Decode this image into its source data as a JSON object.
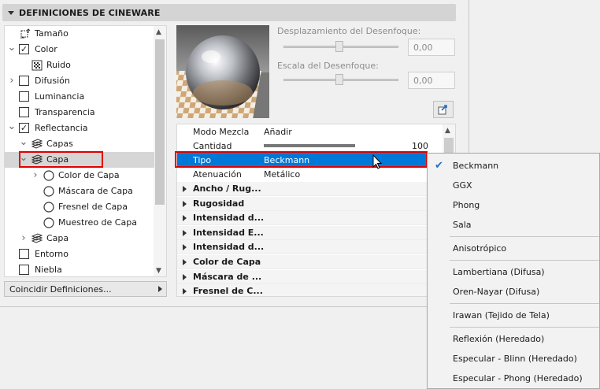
{
  "panel": {
    "title": "DEFINICIONES DE CINEWARE",
    "match_button_label": "Coincidir Definiciones..."
  },
  "tree": {
    "items": [
      {
        "label": "Tamaño",
        "icon": "resize-icon",
        "checkbox": null,
        "expander": null
      },
      {
        "label": "Color",
        "icon": null,
        "checkbox": true,
        "expander": "expanded"
      },
      {
        "label": "Ruido",
        "icon": "noise-icon",
        "checkbox": null,
        "expander": null
      },
      {
        "label": "Difusión",
        "icon": null,
        "checkbox": false,
        "expander": "collapsed"
      },
      {
        "label": "Luminancia",
        "icon": null,
        "checkbox": false,
        "expander": null
      },
      {
        "label": "Transparencia",
        "icon": null,
        "checkbox": false,
        "expander": null
      },
      {
        "label": "Reflectancia",
        "icon": null,
        "checkbox": true,
        "expander": "expanded"
      },
      {
        "label": "Capas",
        "icon": "layers-icon",
        "checkbox": null,
        "expander": "expanded"
      },
      {
        "label": "Capa",
        "icon": "layers-icon",
        "checkbox": null,
        "expander": "expanded",
        "selected": true
      },
      {
        "label": "Color de Capa",
        "icon": "circle-icon",
        "checkbox": null,
        "expander": "collapsed"
      },
      {
        "label": "Máscara de Capa",
        "icon": "circle-icon",
        "checkbox": null,
        "expander": null
      },
      {
        "label": "Fresnel de Capa",
        "icon": "circle-icon",
        "checkbox": null,
        "expander": null
      },
      {
        "label": "Muestreo de Capa",
        "icon": "circle-icon",
        "checkbox": null,
        "expander": null
      },
      {
        "label": "Capa",
        "icon": "layers-icon",
        "checkbox": null,
        "expander": "collapsed"
      },
      {
        "label": "Entorno",
        "icon": null,
        "checkbox": false,
        "expander": null
      },
      {
        "label": "Niebla",
        "icon": null,
        "checkbox": false,
        "expander": null
      }
    ]
  },
  "blur": {
    "offset_label": "Desplazamiento del Desenfoque:",
    "offset_value": "0,00",
    "scale_label": "Escala del Desenfoque:",
    "scale_value": "0,00"
  },
  "properties": {
    "rows": [
      {
        "name": "Modo Mezcla",
        "value": "Añadir"
      },
      {
        "name": "Cantidad",
        "value": "100",
        "level": 0.8
      },
      {
        "name": "Tipo",
        "value": "Beckmann",
        "active": true
      },
      {
        "name": "Atenuación",
        "value": "Metálico"
      }
    ],
    "groups": [
      "Ancho / Rug...",
      "Rugosidad",
      "Intensidad d...",
      "Intensidad E...",
      "Intensidad d...",
      "Color de Capa",
      "Máscara de ...",
      "Fresnel de C..."
    ]
  },
  "dropdown": {
    "selected": "Beckmann",
    "sections": [
      [
        "Beckmann",
        "GGX",
        "Phong",
        "Sala"
      ],
      [
        "Anisotrópico"
      ],
      [
        "Lambertiana (Difusa)",
        "Oren-Nayar (Difusa)"
      ],
      [
        "Irawan (Tejido de Tela)"
      ],
      [
        "Reflexión (Heredado)",
        "Especular - Blinn (Heredado)",
        "Especular - Phong (Heredado)"
      ]
    ]
  },
  "colors": {
    "selection_blue": "#0078d7",
    "highlight_red": "#e00000",
    "check_blue": "#1f6fc5"
  }
}
